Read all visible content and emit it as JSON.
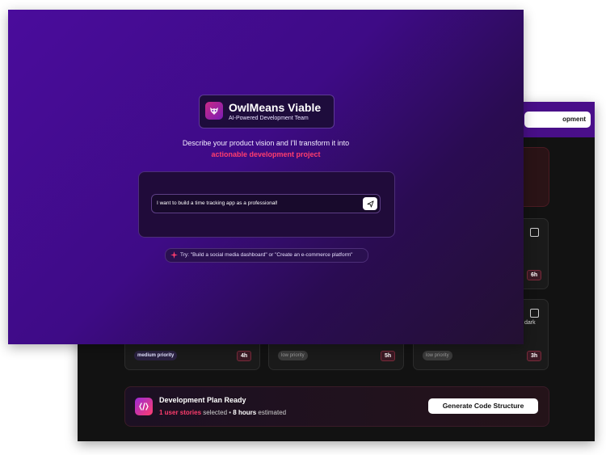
{
  "hero": {
    "app_name": "OwlMeans Viable",
    "app_subtitle": "AI-Powered Development Team",
    "tagline_line1": "Describe your product vision and I'll transform it into",
    "tagline_line2": "actionable development project",
    "input_value": "I want to build a time tracking app as a professional!",
    "try_hint": "Try: \"Build a social media dashboard\" or \"Create an e-commerce platform\""
  },
  "background_app": {
    "top_button_label": "opment",
    "cards": [
      {
        "priority": "",
        "hours": "6h"
      },
      {
        "priority": "medium priority",
        "hours": "4h"
      },
      {
        "priority": "low priority",
        "hours": "5h"
      },
      {
        "priority": "low priority",
        "hours": "3h",
        "side_text": "dark"
      }
    ],
    "plan_bar": {
      "title": "Development Plan Ready",
      "count_text": "1 user stories",
      "selected_word": " selected • ",
      "hours_text": "8 hours",
      "estimated_word": " estimated",
      "button_label": "Generate Code Structure"
    }
  },
  "colors": {
    "accent_pink": "#ff3d6e",
    "hero_purple": "#4a0c9c",
    "dark_bg": "#121212"
  },
  "icons": [
    "owl-logo-icon",
    "send-icon",
    "sparkle-icon",
    "code-icon",
    "checkbox-icon"
  ]
}
